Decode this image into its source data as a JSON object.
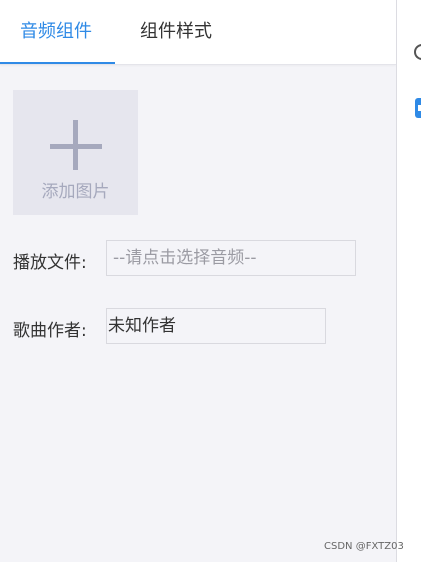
{
  "tabs": [
    {
      "label": "音频组件",
      "active": true
    },
    {
      "label": "组件样式",
      "active": false
    }
  ],
  "add_image": {
    "label": "添加图片",
    "icon": "plus-icon"
  },
  "fields": {
    "file": {
      "label": "播放文件:",
      "placeholder": "--请点击选择音频--",
      "value": ""
    },
    "author": {
      "label": "歌曲作者:",
      "value": "未知作者"
    }
  },
  "watermark": "CSDN @FXTZ03",
  "colors": {
    "accent": "#2f8ae6",
    "panel_bg": "#f4f4f8",
    "placeholder": "#9b9ba3"
  }
}
